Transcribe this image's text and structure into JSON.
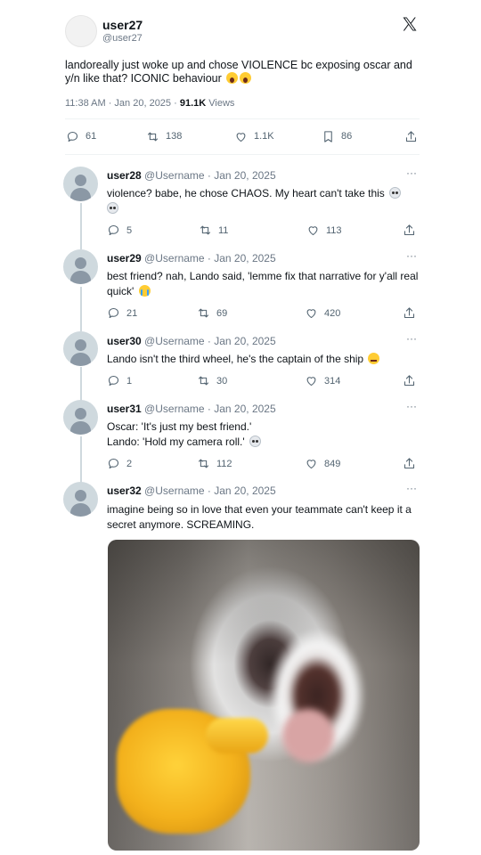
{
  "main_post": {
    "display_name": "user27",
    "handle": "@user27",
    "text": "landoreally just woke up and chose VIOLENCE bc exposing oscar and y/n like that? ICONIC behaviour",
    "time": "11:38 AM · Jan 20, 2025 · ",
    "views_count": "91.1K",
    "views_label": " Views",
    "stats": {
      "replies": "61",
      "retweets": "138",
      "likes": "1.1K",
      "bookmarks": "86"
    }
  },
  "replies": [
    {
      "name": "user28",
      "meta": "@Username · Jan 20, 2025",
      "text": "violence? babe, he chose CHAOS. My heart can't take this",
      "replies": "5",
      "retweets": "11",
      "likes": "113"
    },
    {
      "name": "user29",
      "meta": "@Username · Jan 20, 2025",
      "text": "best friend? nah, Lando said, 'lemme fix that narrative for y'all real quick'",
      "replies": "21",
      "retweets": "69",
      "likes": "420"
    },
    {
      "name": "user30",
      "meta": "@Username · Jan 20, 2025",
      "text": "Lando isn't the third wheel, he's the captain of the ship",
      "replies": "1",
      "retweets": "30",
      "likes": "314"
    },
    {
      "name": "user31",
      "meta": "@Username · Jan 20, 2025",
      "text_line1": "Oscar: 'It's just my best friend.'",
      "text_line2": "Lando: 'Hold my camera roll.'",
      "replies": "2",
      "retweets": "112",
      "likes": "849"
    },
    {
      "name": "user32",
      "meta": "@Username · Jan 20, 2025",
      "text": "imagine being so in love that even your teammate can't keep it a secret anymore. SCREAMING."
    }
  ],
  "more_label": "···",
  "icons": [
    "x-logo-icon",
    "reply-icon",
    "retweet-icon",
    "like-icon",
    "bookmark-icon",
    "share-icon",
    "more-icon"
  ]
}
